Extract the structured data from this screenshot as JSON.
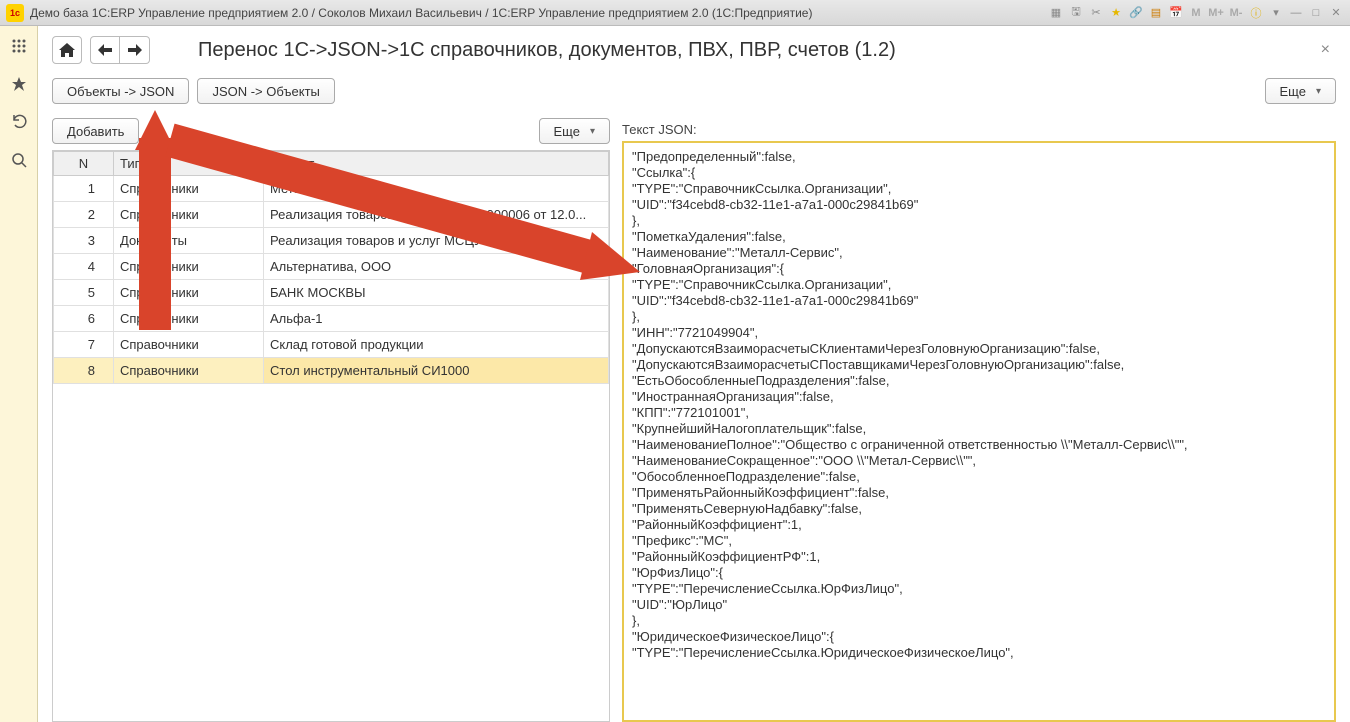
{
  "titlebar": {
    "title": "Демо база 1С:ERP Управление предприятием 2.0 / Соколов Михаил Васильевич / 1С:ERP Управление предприятием 2.0  (1С:Предприятие)",
    "winbuttons": [
      "M",
      "M+",
      "M-"
    ]
  },
  "page": {
    "title": "Перенос 1С->JSON->1С справочников, документов, ПВХ, ПВР, счетов (1.2)"
  },
  "buttons": {
    "objects_to_json": "Объекты -> JSON",
    "json_to_objects": "JSON -> Объекты",
    "more": "Еще",
    "add": "Добавить",
    "more2": "Еще"
  },
  "table": {
    "headers": {
      "n": "N",
      "type": "Тип",
      "object": "Объект"
    },
    "rows": [
      {
        "n": "1",
        "type": "Справочники",
        "object": "Металл-Сервис"
      },
      {
        "n": "2",
        "type": "Справочники",
        "object": "Реализация товаров и услуг МСЦУ-000006 от 12.0..."
      },
      {
        "n": "3",
        "type": "Документы",
        "object": "Реализация товаров и услуг МСЦУ-000004 от 30.0..."
      },
      {
        "n": "4",
        "type": "Справочники",
        "object": "Альтернатива, ООО"
      },
      {
        "n": "5",
        "type": "Справочники",
        "object": "БАНК МОСКВЫ"
      },
      {
        "n": "6",
        "type": "Справочники",
        "object": "Альфа-1"
      },
      {
        "n": "7",
        "type": "Справочники",
        "object": "Склад готовой продукции"
      },
      {
        "n": "8",
        "type": "Справочники",
        "object": "Стол инструментальный СИ1000"
      }
    ],
    "selected_index": 7
  },
  "json_panel": {
    "label": "Текст JSON:",
    "text": "\"Предопределенный\":false,\n\"Ссылка\":{\n\"TYPE\":\"СправочникСсылка.Организации\",\n\"UID\":\"f34cebd8-cb32-11e1-a7a1-000c29841b69\"\n},\n\"ПометкаУдаления\":false,\n\"Наименование\":\"Металл-Сервис\",\n\"ГоловнаяОрганизация\":{\n\"TYPE\":\"СправочникСсылка.Организации\",\n\"UID\":\"f34cebd8-cb32-11e1-a7a1-000c29841b69\"\n},\n\"ИНН\":\"7721049904\",\n\"ДопускаютсяВзаиморасчетыСКлиентамиЧерезГоловнуюОрганизацию\":false,\n\"ДопускаютсяВзаиморасчетыСПоставщикамиЧерезГоловнуюОрганизацию\":false,\n\"ЕстьОбособленныеПодразделения\":false,\n\"ИностраннаяОрганизация\":false,\n\"КПП\":\"772101001\",\n\"КрупнейшийНалогоплательщик\":false,\n\"НаименованиеПолное\":\"Общество с ограниченной ответственностью \\\\\"Металл-Сервис\\\\\"\",\n\"НаименованиеСокращенное\":\"ООО \\\\\"Метал-Сервис\\\\\"\",\n\"ОбособленноеПодразделение\":false,\n\"ПрименятьРайонныйКоэффициент\":false,\n\"ПрименятьСевернуюНадбавку\":false,\n\"РайонныйКоэффициент\":1,\n\"Префикс\":\"МС\",\n\"РайонныйКоэффициентРФ\":1,\n\"ЮрФизЛицо\":{\n\"TYPE\":\"ПеречислениеСсылка.ЮрФизЛицо\",\n\"UID\":\"ЮрЛицо\"\n},\n\"ЮридическоеФизическоеЛицо\":{\n\"TYPE\":\"ПеречислениеСсылка.ЮридическоеФизическоеЛицо\","
  }
}
